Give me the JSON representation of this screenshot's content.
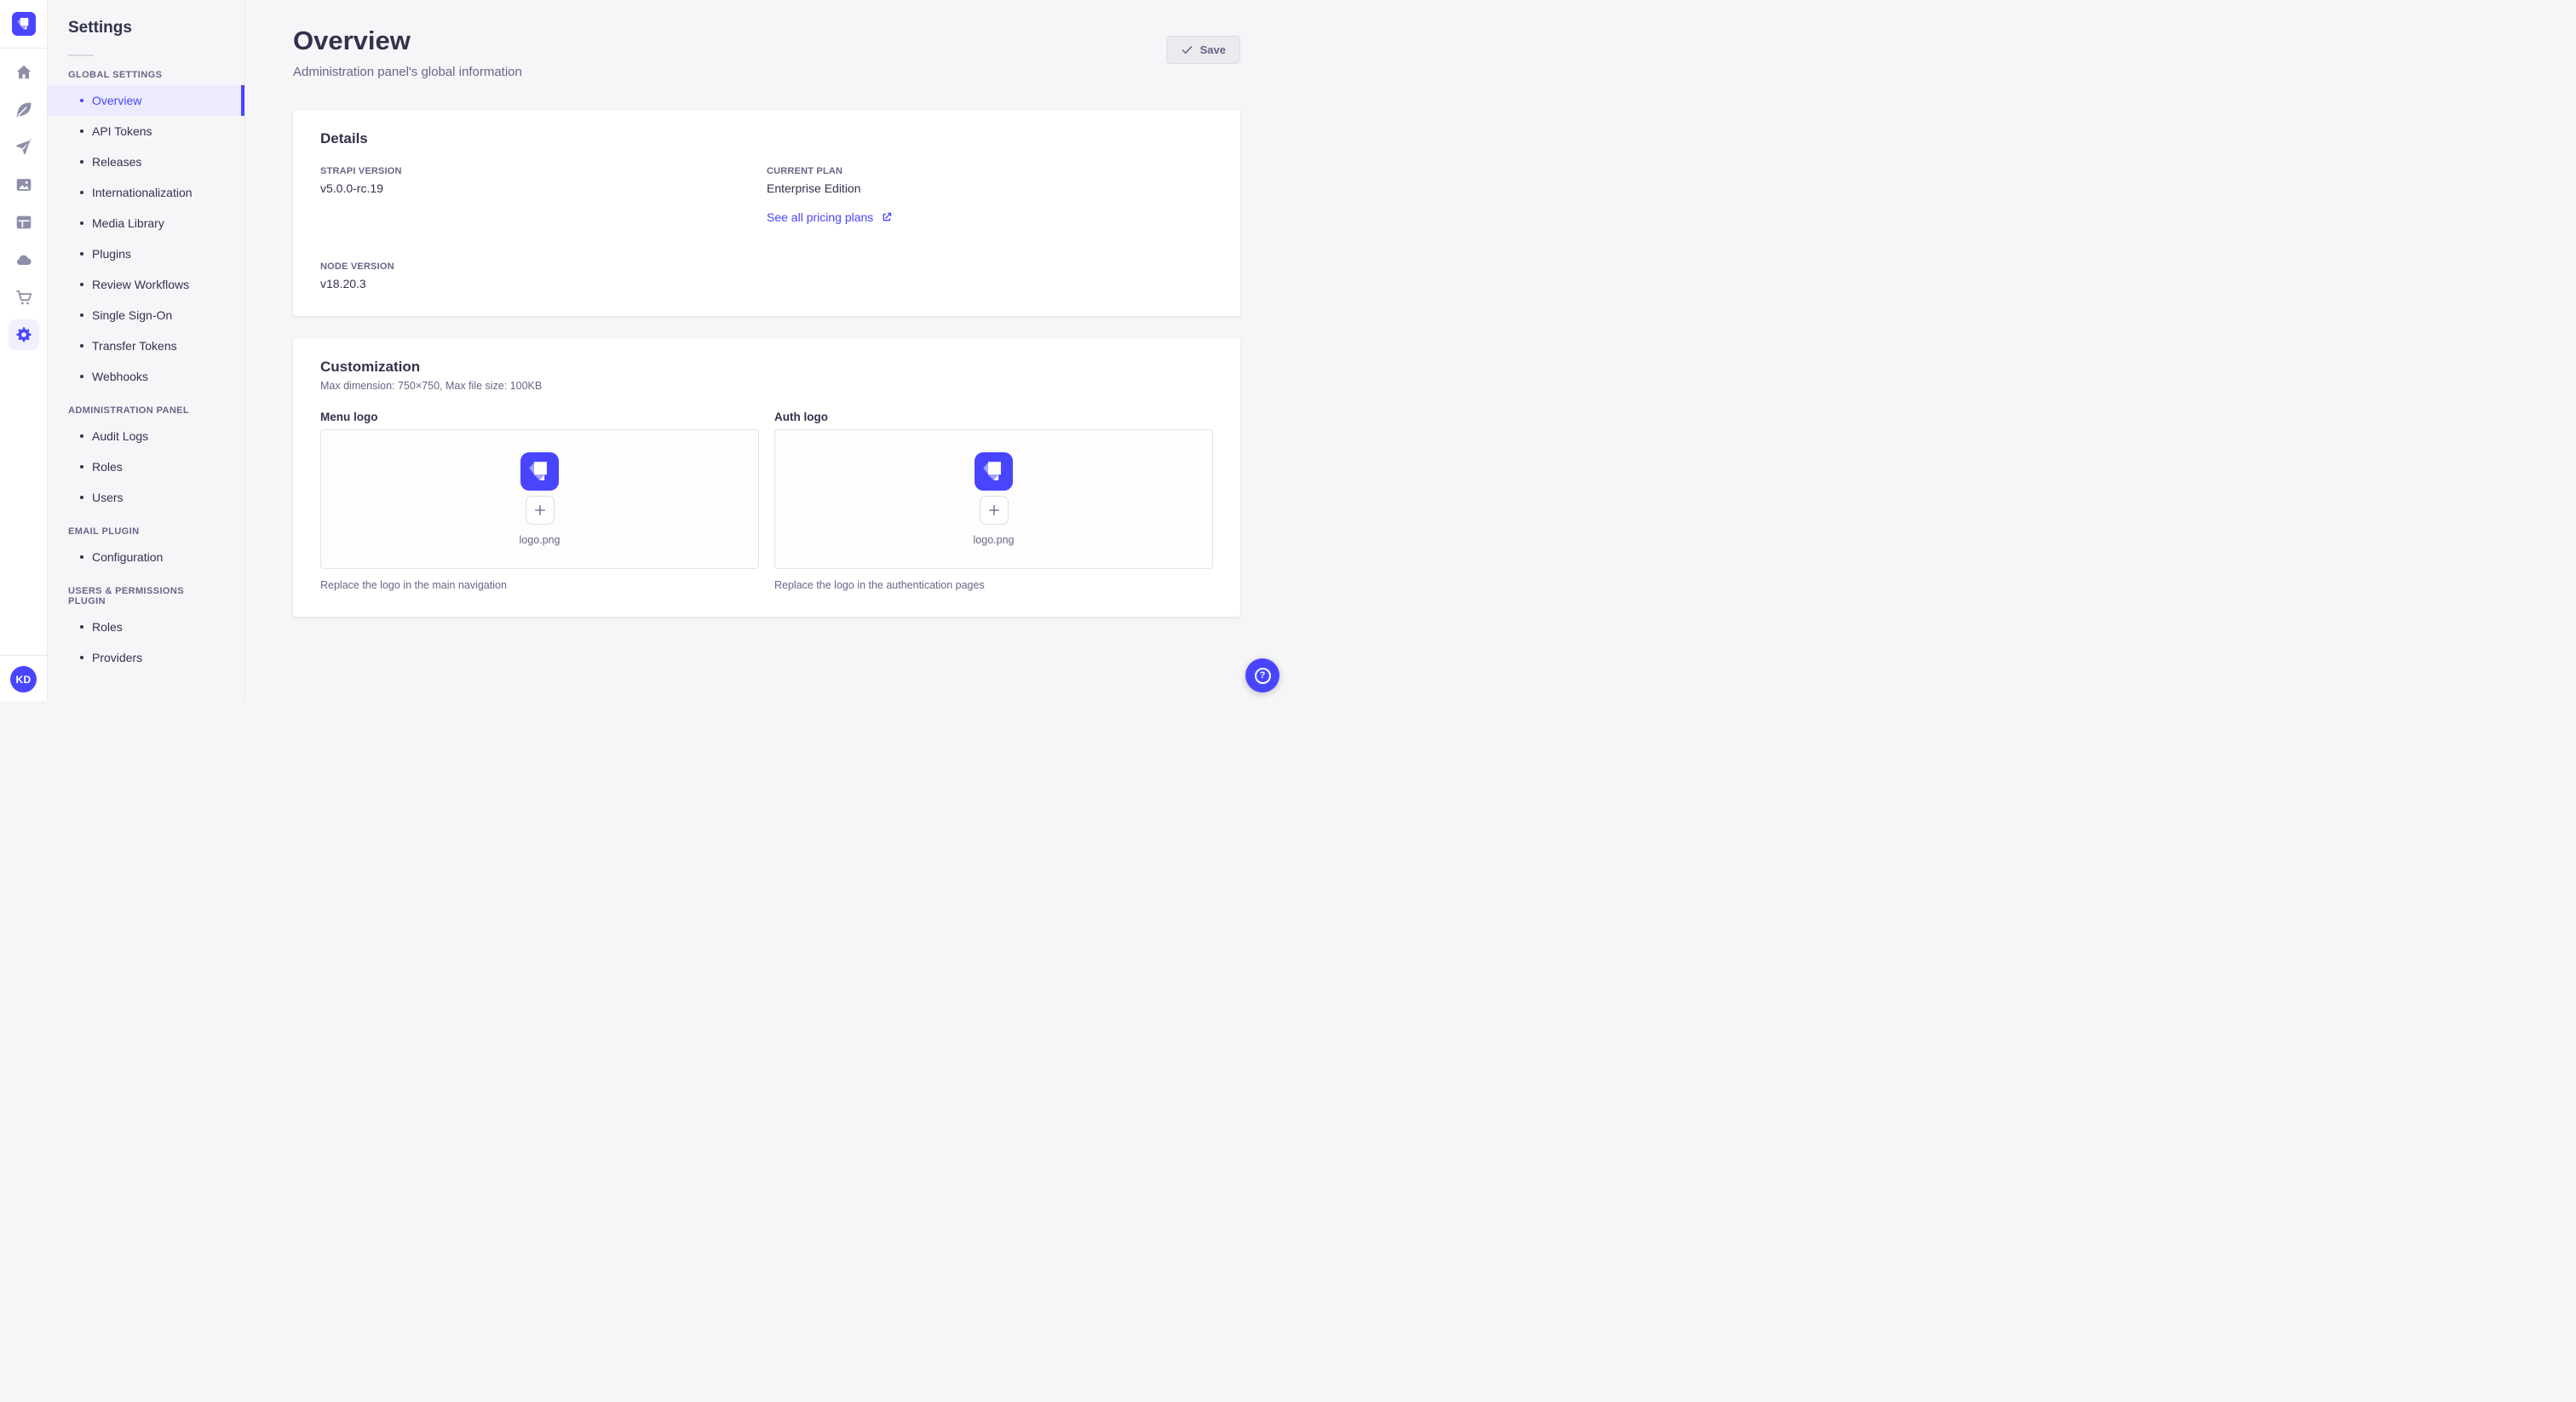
{
  "colors": {
    "primary": "#4945ff",
    "text_dark": "#32324d",
    "text_muted": "#666687",
    "selected_bg": "#ebeafe",
    "page_bg": "#f6f6f9"
  },
  "nav_rail": {
    "logo_icon": "strapi-logo",
    "icons": [
      "home-icon",
      "feather-icon",
      "paper-plane-icon",
      "images-icon",
      "layout-icon",
      "cloud-icon",
      "cart-icon",
      "gear-icon"
    ],
    "active_icon": "gear-icon",
    "avatar_initials": "KD"
  },
  "sidebar": {
    "title": "Settings",
    "sections": [
      {
        "label": "GLOBAL SETTINGS",
        "items": [
          "Overview",
          "API Tokens",
          "Releases",
          "Internationalization",
          "Media Library",
          "Plugins",
          "Review Workflows",
          "Single Sign-On",
          "Transfer Tokens",
          "Webhooks"
        ]
      },
      {
        "label": "ADMINISTRATION PANEL",
        "items": [
          "Audit Logs",
          "Roles",
          "Users"
        ]
      },
      {
        "label": "EMAIL PLUGIN",
        "items": [
          "Configuration"
        ]
      },
      {
        "label": "USERS & PERMISSIONS PLUGIN",
        "items": [
          "Roles",
          "Providers"
        ]
      }
    ],
    "active_item": "Overview"
  },
  "header": {
    "title": "Overview",
    "subtitle": "Administration panel's global information",
    "save_label": "Save"
  },
  "details_card": {
    "title": "Details",
    "fields": [
      {
        "label": "STRAPI VERSION",
        "value": "v5.0.0-rc.19"
      },
      {
        "label": "CURRENT PLAN",
        "value": "Enterprise Edition",
        "link": "See all pricing plans"
      },
      {
        "label": "NODE VERSION",
        "value": "v18.20.3"
      }
    ]
  },
  "customization_card": {
    "title": "Customization",
    "subtitle": "Max dimension: 750×750, Max file size: 100KB",
    "uploads": [
      {
        "label": "Menu logo",
        "filename": "logo.png",
        "hint": "Replace the logo in the main navigation"
      },
      {
        "label": "Auth logo",
        "filename": "logo.png",
        "hint": "Replace the logo in the authentication pages"
      }
    ]
  },
  "help_button": {
    "icon": "question-mark-icon",
    "glyph": "?"
  }
}
